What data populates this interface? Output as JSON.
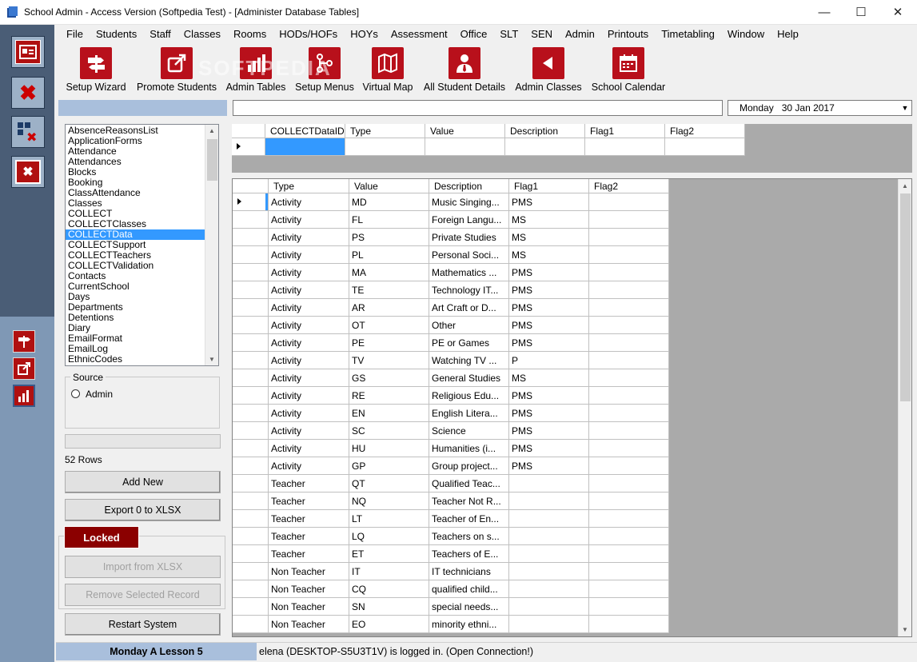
{
  "window": {
    "title": "School Admin - Access Version (Softpedia Test) - [Administer Database Tables]",
    "minimize": "—",
    "maximize": "☐",
    "close": "✕"
  },
  "menu": [
    "File",
    "Students",
    "Staff",
    "Classes",
    "Rooms",
    "HODs/HOFs",
    "HOYs",
    "Assessment",
    "Office",
    "SLT",
    "SEN",
    "Admin",
    "Printouts",
    "Timetabling",
    "Window",
    "Help"
  ],
  "toolbar": [
    {
      "label": "Setup Wizard",
      "icon": "signpost-icon"
    },
    {
      "label": "Promote Students",
      "icon": "external-link-icon"
    },
    {
      "label": "Admin Tables",
      "icon": "bar-chart-icon"
    },
    {
      "label": "Setup Menus",
      "icon": "branch-icon"
    },
    {
      "label": "Virtual Map",
      "icon": "map-icon"
    },
    {
      "label": "All Student Details",
      "icon": "person-icon"
    },
    {
      "label": "Admin Classes",
      "icon": "arrow-left-icon"
    },
    {
      "label": "School Calendar",
      "icon": "calendar-icon"
    }
  ],
  "watermark": "SOFTPEDIA",
  "date": {
    "day": "Monday",
    "value": "30 Jan 2017"
  },
  "tables_list": {
    "items": [
      "AbsenceReasonsList",
      "ApplicationForms",
      "Attendance",
      "Attendances",
      "Blocks",
      "Booking",
      "ClassAttendance",
      "Classes",
      "COLLECT",
      "COLLECTClasses",
      "COLLECTData",
      "COLLECTSupport",
      "COLLECTTeachers",
      "COLLECTValidation",
      "Contacts",
      "CurrentSchool",
      "Days",
      "Departments",
      "Detentions",
      "Diary",
      "EmailFormat",
      "EmailLog",
      "EthnicCodes"
    ],
    "selected": "COLLECTData"
  },
  "source": {
    "title": "Source",
    "option": "Admin"
  },
  "row_count": "52 Rows",
  "buttons": {
    "add_new": "Add New",
    "export": "Export 0 to XLSX",
    "locked": "Locked",
    "import": "Import from XLSX",
    "remove": "Remove Selected Record",
    "restart": "Restart System"
  },
  "grid_top": {
    "columns": [
      "COLLECTDataID",
      "Type",
      "Value",
      "Description",
      "Flag1",
      "Flag2"
    ]
  },
  "grid_main": {
    "columns": [
      "Type",
      "Value",
      "Description",
      "Flag1",
      "Flag2"
    ],
    "rows": [
      [
        "Activity",
        "MD",
        "Music Singing...",
        "PMS",
        ""
      ],
      [
        "Activity",
        "FL",
        "Foreign Langu...",
        "MS",
        ""
      ],
      [
        "Activity",
        "PS",
        "Private Studies",
        "MS",
        ""
      ],
      [
        "Activity",
        "PL",
        "Personal Soci...",
        "MS",
        ""
      ],
      [
        "Activity",
        "MA",
        "Mathematics ...",
        "PMS",
        ""
      ],
      [
        "Activity",
        "TE",
        "Technology IT...",
        "PMS",
        ""
      ],
      [
        "Activity",
        "AR",
        "Art Craft or D...",
        "PMS",
        ""
      ],
      [
        "Activity",
        "OT",
        "Other",
        "PMS",
        ""
      ],
      [
        "Activity",
        "PE",
        "PE or Games",
        "PMS",
        ""
      ],
      [
        "Activity",
        "TV",
        "Watching TV ...",
        "P",
        ""
      ],
      [
        "Activity",
        "GS",
        "General Studies",
        "MS",
        ""
      ],
      [
        "Activity",
        "RE",
        "Religious Edu...",
        "PMS",
        ""
      ],
      [
        "Activity",
        "EN",
        "English Litera...",
        "PMS",
        ""
      ],
      [
        "Activity",
        "SC",
        "Science",
        "PMS",
        ""
      ],
      [
        "Activity",
        "HU",
        "Humanities (i...",
        "PMS",
        ""
      ],
      [
        "Activity",
        "GP",
        "Group project...",
        "PMS",
        ""
      ],
      [
        "Teacher",
        "QT",
        "Qualified Teac...",
        "",
        ""
      ],
      [
        "Teacher",
        "NQ",
        "Teacher Not R...",
        "",
        ""
      ],
      [
        "Teacher",
        "LT",
        "Teacher of En...",
        "",
        ""
      ],
      [
        "Teacher",
        "LQ",
        "Teachers on s...",
        "",
        ""
      ],
      [
        "Teacher",
        "ET",
        "Teachers of E...",
        "",
        ""
      ],
      [
        "Non Teacher",
        "IT",
        "IT technicians",
        "",
        ""
      ],
      [
        "Non Teacher",
        "CQ",
        "qualified child...",
        "",
        ""
      ],
      [
        "Non Teacher",
        "SN",
        "special needs...",
        "",
        ""
      ],
      [
        "Non Teacher",
        "EO",
        "minority ethni...",
        "",
        ""
      ]
    ]
  },
  "status": {
    "lesson": "Monday A Lesson 5",
    "message": "elena (DESKTOP-S5U3T1V) is logged in. (Open Connection!)"
  }
}
